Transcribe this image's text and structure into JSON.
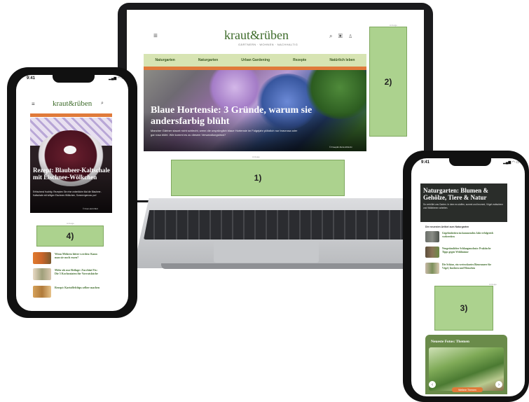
{
  "laptop": {
    "logo": "kraut&rüben",
    "tagline": "GÄRTNERN · WOHNEN · NACHHALTIG",
    "menu_icon": "≡",
    "header_icons": "⌕ ▣ ♙",
    "nav": [
      "Naturgarten",
      "Naturgarten",
      "Urban Gardening",
      "Rezepte",
      "Natürlich leben"
    ],
    "hero_title": "Blaue Hortensie: 3 Gründe, warum sie andersfarbig blüht",
    "hero_text": "Mancher Gärtner staunt nicht schlecht, wenn die ursprünglich blaue Hortensie im Folgejahr plötzlich nur bravrosa oder gar rosa blüht. Wie kommt es zu diesem Verwandlungstrick?",
    "credit": "© Freepik/ Akira Abbrobi",
    "ad_label": "Anzeige",
    "ad1_label": "1)",
    "ad2_label": "2)"
  },
  "left_phone": {
    "time": "9:41",
    "status": "▂▄▆ ◠ ▭",
    "menu_icon": "≡",
    "logo": "kraut&rüben",
    "search_icon": "⌕",
    "hero_title": "Rezept: Blaubeer-Kaltschale mit Eischnee-Wölkchen",
    "hero_text": "Erfrischend fruchtig: Rezepten Sie eine ordentliche Mal die Blaubeer-Kaltschale mit luftigen Eischnee-Wölkchen, Sommergenuss pur!",
    "credit": "© Kraut-Hertz-Betz",
    "ad_label": "Anzeige",
    "ad4_label": "4)",
    "items": [
      "Wenn Möhren bitter werden: Kann man sie noch essen?",
      "Mehr als nur Beilage: Zucchini Fix: Die 5 Kochzutaten für Vorratsküche",
      "Rezept: Kartoffelchips selber machen"
    ]
  },
  "right_phone": {
    "time": "9:41",
    "status": "▂▄▆ ◠ ▭",
    "hero_title": "Naturgarten: Blumen & Gehölze, Tiere & Natur",
    "hero_text": "So verblüht uns Garten. In dem es stuffen, summt und brummt, Vögel zwitschern und Wildbienen arbeiten.",
    "credit": "© Autor: aktuell und Alexa Rind",
    "section_title": "Die neuesten Artikel zum Naturgarten",
    "items": [
      "Gegebenheiten im kommenden Jahr erfolgreich vorbereiten",
      "Neugetümlicher Schlangenschutz: Praktische Tipps gegen Wühlmäuse",
      "Die Schöne, ein vertrocknetes Bienenmeer für Vögel, Insekten und Menschen"
    ],
    "ad_label": "Anzeige",
    "ad3_label": "3)",
    "green_title": "Neueste Fotos: Themen",
    "button": "Weitere Themen",
    "prev_icon": "‹",
    "next_icon": "›"
  }
}
